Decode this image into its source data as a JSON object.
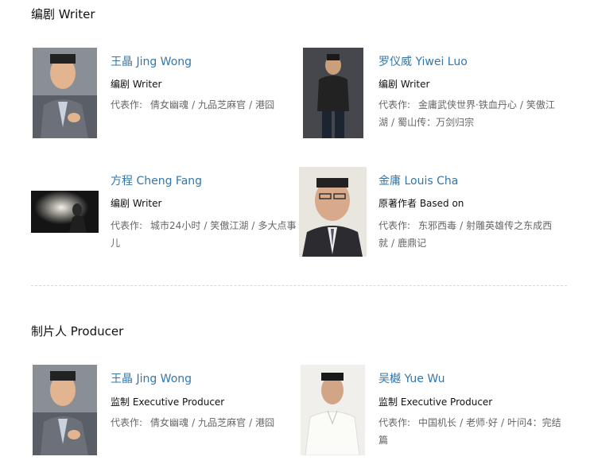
{
  "sections": {
    "writer": {
      "title": "编剧 Writer",
      "people": [
        {
          "name": "王晶 Jing Wong",
          "role": "编剧 Writer",
          "works_label": "代表作:",
          "works": [
            "倩女幽魂",
            "九品芝麻官",
            "港囧"
          ]
        },
        {
          "name": "罗仪威 Yiwei Luo",
          "role": "编剧 Writer",
          "works_label": "代表作:",
          "works": [
            "金庸武侠世界·铁血丹心",
            "笑傲江湖",
            "蜀山传：万剑归宗"
          ]
        },
        {
          "name": "方程 Cheng Fang",
          "role": "编剧 Writer",
          "works_label": "代表作:",
          "works": [
            "城市24小时",
            "笑傲江湖",
            "多大点事儿"
          ]
        },
        {
          "name": "金庸 Louis Cha",
          "role": "原著作者 Based on",
          "works_label": "代表作:",
          "works": [
            "东邪西毒",
            "射雕英雄传之东成西就",
            "鹿鼎记"
          ]
        }
      ]
    },
    "producer": {
      "title": "制片人 Producer",
      "people": [
        {
          "name": "王晶 Jing Wong",
          "role": "监制 Executive Producer",
          "works_label": "代表作:",
          "works": [
            "倩女幽魂",
            "九品芝麻官",
            "港囧"
          ]
        },
        {
          "name": "吴樾 Yue Wu",
          "role": "监制 Executive Producer",
          "works_label": "代表作:",
          "works": [
            "中国机长",
            "老师·好",
            "叶问4：完结篇"
          ]
        }
      ]
    }
  }
}
